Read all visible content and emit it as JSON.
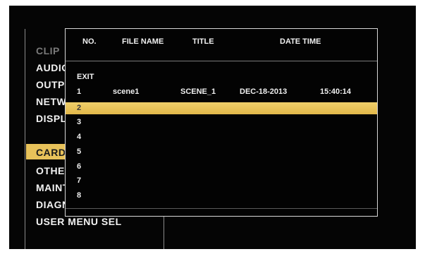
{
  "menu": {
    "items": [
      {
        "label": "CLIP",
        "state": "dim"
      },
      {
        "label": "AUDIO",
        "state": "normal"
      },
      {
        "label": "OUTPUT",
        "state": "normal"
      },
      {
        "label": "NETWORK",
        "state": "normal"
      },
      {
        "label": "DISPLAY",
        "state": "normal"
      },
      {
        "label": "CARD",
        "state": "selected"
      },
      {
        "label": "OTHERS",
        "state": "normal"
      },
      {
        "label": "MAINTENANCE",
        "state": "normal"
      },
      {
        "label": "DIAGNOSTIC",
        "state": "normal"
      },
      {
        "label": "USER MENU SEL",
        "state": "normal"
      }
    ],
    "highlight_color": "#e8c25a"
  },
  "dialog": {
    "columns": {
      "no": "NO.",
      "file_name": "FILE NAME",
      "title": "TITLE",
      "date_time": "DATE TIME"
    },
    "rows": [
      {
        "no": "EXIT",
        "file_name": "",
        "title": "",
        "date": "",
        "time": ""
      },
      {
        "no": "1",
        "file_name": "scene1",
        "title": "SCENE_1",
        "date": "DEC-18-2013",
        "time": "15:40:14"
      },
      {
        "no": "2",
        "file_name": "",
        "title": "",
        "date": "",
        "time": "",
        "selected": true
      },
      {
        "no": "3",
        "file_name": "",
        "title": "",
        "date": "",
        "time": ""
      },
      {
        "no": "4",
        "file_name": "",
        "title": "",
        "date": "",
        "time": ""
      },
      {
        "no": "5",
        "file_name": "",
        "title": "",
        "date": "",
        "time": ""
      },
      {
        "no": "6",
        "file_name": "",
        "title": "",
        "date": "",
        "time": ""
      },
      {
        "no": "7",
        "file_name": "",
        "title": "",
        "date": "",
        "time": ""
      },
      {
        "no": "8",
        "file_name": "",
        "title": "",
        "date": "",
        "time": ""
      }
    ],
    "selection_color": "#e8c25a"
  }
}
